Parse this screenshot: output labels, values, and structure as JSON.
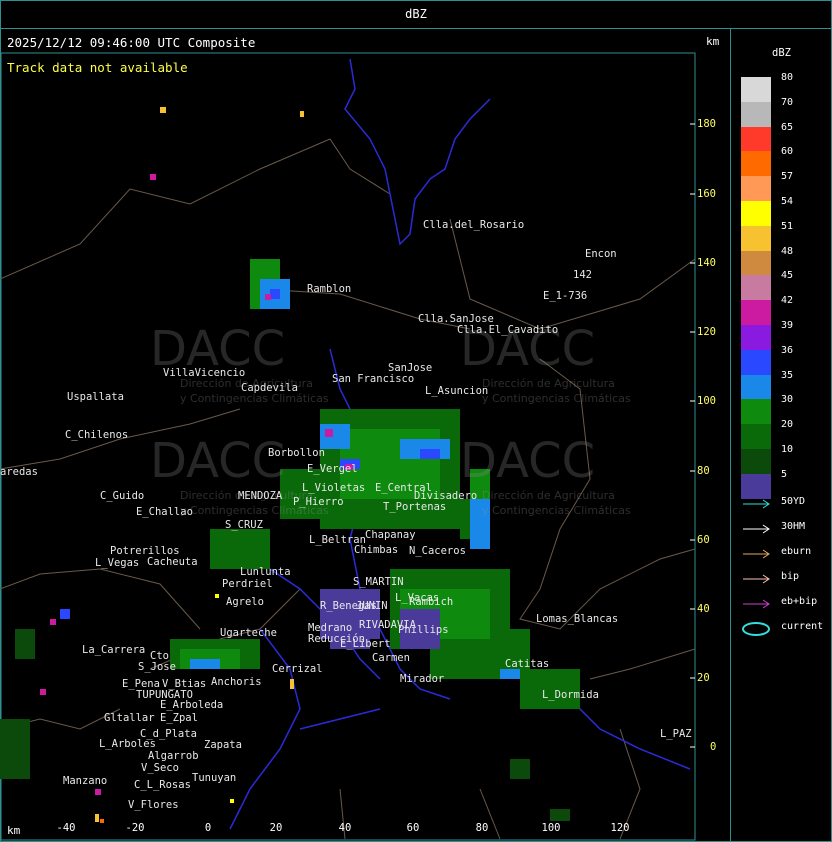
{
  "header": {
    "title": "dBZ"
  },
  "map": {
    "timestamp": "2025/12/12 09:46:00 UTC Composite",
    "track_notice": "Track data not available",
    "km_unit": "km",
    "y_ticks": [
      "180",
      "160",
      "140",
      "120",
      "100",
      "80",
      "60",
      "40",
      "20",
      "0"
    ],
    "x_ticks": [
      "-40",
      "-20",
      "0",
      "20",
      "40",
      "60",
      "80",
      "100",
      "120"
    ],
    "watermark": {
      "logo_text": "DACC",
      "subtitle_line1": "Dirección de Agricultura",
      "subtitle_line2": "y Contingencias Climáticas"
    },
    "places": [
      {
        "name": "Clla.del_Rosario"
      },
      {
        "name": "Encon"
      },
      {
        "name": "142"
      },
      {
        "name": "E_1-736"
      },
      {
        "name": "Ramblon"
      },
      {
        "name": "Clla.SanJose"
      },
      {
        "name": "Clla.El_Cavadito"
      },
      {
        "name": "VillaVicencio"
      },
      {
        "name": "Capdevila"
      },
      {
        "name": "SanJose"
      },
      {
        "name": "San Francisco"
      },
      {
        "name": "L_Asuncion"
      },
      {
        "name": "Uspallata"
      },
      {
        "name": "C_Chilenos"
      },
      {
        "name": "aredas"
      },
      {
        "name": "Borbollon"
      },
      {
        "name": "E_Vergel"
      },
      {
        "name": "L_Violetas"
      },
      {
        "name": "E_Central"
      },
      {
        "name": "Divisadero"
      },
      {
        "name": "C_Guido"
      },
      {
        "name": "MENDOZA"
      },
      {
        "name": "P_Hierro"
      },
      {
        "name": "T_Portenas"
      },
      {
        "name": "E_Challao"
      },
      {
        "name": "S_CRUZ"
      },
      {
        "name": "L_Beltran"
      },
      {
        "name": "Chapanay"
      },
      {
        "name": "Chimbas"
      },
      {
        "name": "N_Caceros"
      },
      {
        "name": "Potrerillos"
      },
      {
        "name": "L_Vegas"
      },
      {
        "name": "Cacheuta"
      },
      {
        "name": "Lunlunta"
      },
      {
        "name": "Perdriel"
      },
      {
        "name": "S_MARTIN"
      },
      {
        "name": "Agrelo"
      },
      {
        "name": "R_Benegas"
      },
      {
        "name": "JUNIN"
      },
      {
        "name": "L_Vacas"
      },
      {
        "name": "Rambich"
      },
      {
        "name": "Lomas_Blancas"
      },
      {
        "name": "Ugarteche"
      },
      {
        "name": "RIVADAVIA"
      },
      {
        "name": "Phillips"
      },
      {
        "name": "La_Carrera"
      },
      {
        "name": "Medrano"
      },
      {
        "name": "Reducción"
      },
      {
        "name": "E_Libert"
      },
      {
        "name": "Catitas"
      },
      {
        "name": "Cto"
      },
      {
        "name": "S_Jose"
      },
      {
        "name": "Cerrizal"
      },
      {
        "name": "Carmen"
      },
      {
        "name": "E_Pena"
      },
      {
        "name": "V_Btias"
      },
      {
        "name": "Anchoris"
      },
      {
        "name": "Mirador"
      },
      {
        "name": "TUPUNGATO"
      },
      {
        "name": "L_Dormida"
      },
      {
        "name": "E_Arboleda"
      },
      {
        "name": "Gltallar"
      },
      {
        "name": "E_Zpal"
      },
      {
        "name": "C_d_Plata"
      },
      {
        "name": "L_Arboles"
      },
      {
        "name": "Zapata"
      },
      {
        "name": "Algarrob"
      },
      {
        "name": "V_Seco"
      },
      {
        "name": "Tunuyan"
      },
      {
        "name": "C_L_Rosas"
      },
      {
        "name": "Manzano"
      },
      {
        "name": "V_Flores"
      },
      {
        "name": "L_PAZ"
      }
    ]
  },
  "legend": {
    "unit": "dBZ",
    "scale": [
      {
        "label": "80",
        "color": "#d8d8d8"
      },
      {
        "label": "70",
        "color": "#b8b8b8"
      },
      {
        "label": "65",
        "color": "#ff3a2a"
      },
      {
        "label": "60",
        "color": "#ff6a00"
      },
      {
        "label": "57",
        "color": "#ff9955"
      },
      {
        "label": "54",
        "color": "#ffff00"
      },
      {
        "label": "51",
        "color": "#f6c230"
      },
      {
        "label": "48",
        "color": "#d08a40"
      },
      {
        "label": "45",
        "color": "#c87aa0"
      },
      {
        "label": "42",
        "color": "#cc1ba0"
      },
      {
        "label": "39",
        "color": "#8a1ae0"
      },
      {
        "label": "36",
        "color": "#2a48ff"
      },
      {
        "label": "35",
        "color": "#1a88e8"
      },
      {
        "label": "30",
        "color": "#0e8a0e"
      },
      {
        "label": "20",
        "color": "#0a6a0a"
      },
      {
        "label": "10",
        "color": "#0c4a0c"
      },
      {
        "label": "5",
        "color": "#4a3a9a"
      }
    ],
    "tracks": [
      {
        "label": "50YD",
        "color": "#33dddd"
      },
      {
        "label": "30HM",
        "color": "#ffffff"
      },
      {
        "label": "eburn",
        "color": "#e8a860"
      },
      {
        "label": "bip",
        "color": "#ffc0b0"
      },
      {
        "label": "eb+bip",
        "color": "#d040d0"
      },
      {
        "label": "current",
        "color": "#33dddd"
      }
    ]
  }
}
